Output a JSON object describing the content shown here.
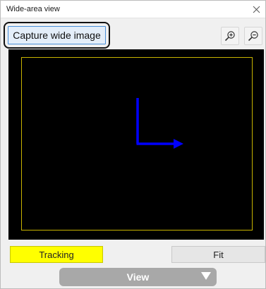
{
  "window": {
    "title": "Wide-area view",
    "close_icon": "close-icon"
  },
  "toolbar": {
    "capture_label": "Capture wide image",
    "zoom_in_icon": "zoom-in-icon",
    "zoom_out_icon": "zoom-out-icon"
  },
  "viewport": {
    "background": "#000000",
    "frame_color": "#c8b400",
    "axis_color": "#0000ff",
    "axis_icon": "xy-axis-arrow-icon"
  },
  "controls": {
    "tracking_label": "Tracking",
    "tracking_color": "#ffff00",
    "fit_label": "Fit",
    "view_label": "View",
    "view_dropdown_icon": "chevron-down-icon"
  }
}
